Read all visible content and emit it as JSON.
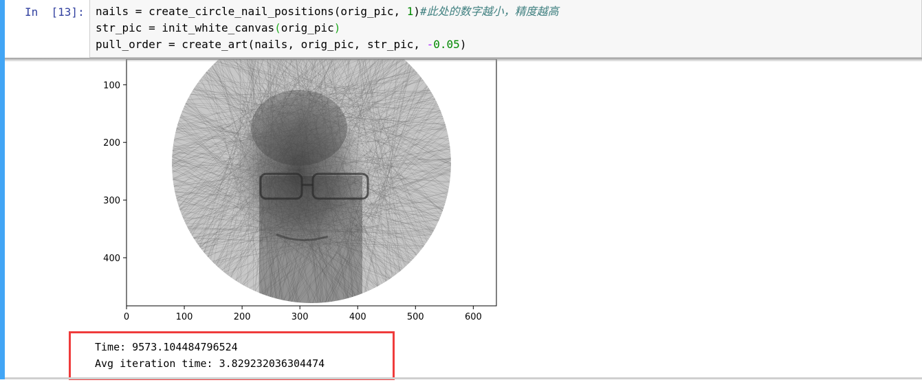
{
  "cell": {
    "prompt": "In  [13]:",
    "code": {
      "line1_prefix": "nails = create_circle_nail_positions(orig_pic, ",
      "line1_num": "1",
      "line1_close": ")",
      "line1_comment": "#此处的数字越小，精度越高",
      "line2_prefix": "str_pic = init_white_canvas",
      "line2_open": "(",
      "line2_arg": "orig_pic",
      "line2_close": ")",
      "line3_prefix": "pull_order = create_art(nails, orig_pic, str_pic, ",
      "line3_op": "-",
      "line3_num": "0.05",
      "line3_close": ")"
    }
  },
  "plot": {
    "y_ticks": [
      "100",
      "200",
      "300",
      "400"
    ],
    "x_ticks": [
      "0",
      "100",
      "200",
      "300",
      "400",
      "500",
      "600"
    ]
  },
  "output": {
    "time_line": "Time: 9573.104484796524",
    "avg_line": "Avg iteration time: 3.829232036304474"
  },
  "colors": {
    "accent_bar": "#42a5f5",
    "highlight_box": "#ef3b3b",
    "prompt_color": "#303f9f"
  }
}
